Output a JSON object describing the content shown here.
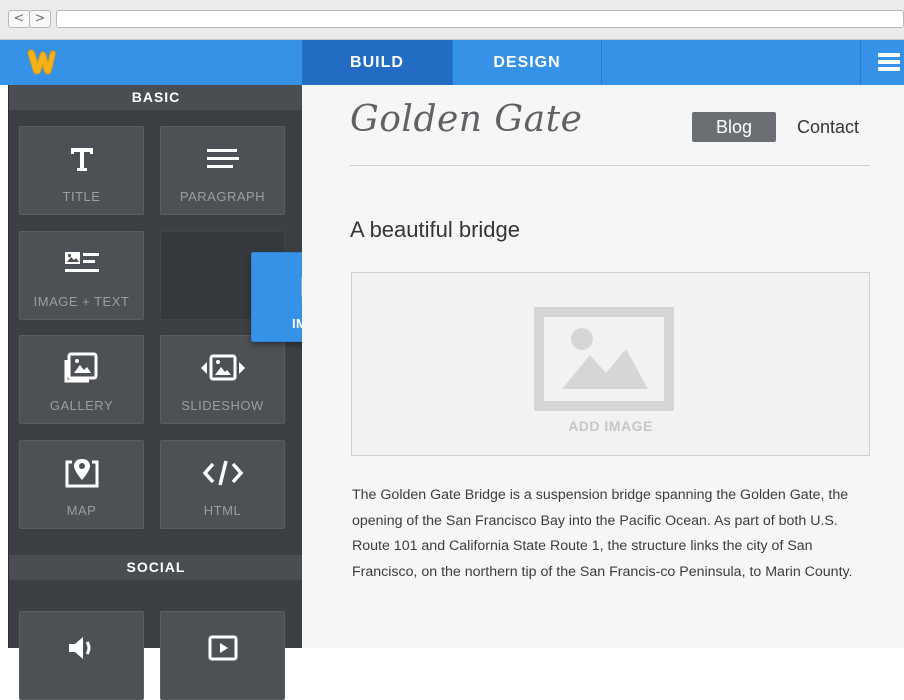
{
  "browser": {
    "back_glyph": "<",
    "forward_glyph": ">"
  },
  "topbar": {
    "logo_icon": "weebly-w-logo-icon",
    "tabs": [
      {
        "label": "BUILD",
        "active": true
      },
      {
        "label": "DESIGN",
        "active": false
      }
    ],
    "menu_icon": "hamburger-menu-icon",
    "accent_color": "#3592e7",
    "active_tab_color": "#226cc4"
  },
  "sidebar": {
    "sections": [
      {
        "heading": "BASIC",
        "tiles": [
          {
            "label": "TITLE",
            "icon": "title-t-icon"
          },
          {
            "label": "PARAGRAPH",
            "icon": "paragraph-lines-icon"
          },
          {
            "label": "IMAGE + TEXT",
            "icon": "image-text-icon"
          },
          {
            "label": "",
            "icon": ""
          },
          {
            "label": "GALLERY",
            "icon": "gallery-icon"
          },
          {
            "label": "SLIDESHOW",
            "icon": "slideshow-icon"
          },
          {
            "label": "MAP",
            "icon": "map-pin-icon"
          },
          {
            "label": "HTML",
            "icon": "html-code-icon"
          }
        ]
      },
      {
        "heading": "SOCIAL",
        "tiles": [
          {
            "label": "",
            "icon": "audio-speaker-icon"
          },
          {
            "label": "",
            "icon": "video-play-icon"
          }
        ]
      }
    ],
    "dragging_tile": {
      "label": "IMAGE",
      "icon": "image-icon"
    }
  },
  "site": {
    "title": "Golden Gate",
    "nav": [
      {
        "label": "Blog",
        "active": true
      },
      {
        "label": "Contact",
        "active": false
      }
    ],
    "heading": "A beautiful bridge",
    "image_placeholder": {
      "label": "ADD IMAGE",
      "icon": "image-placeholder-icon"
    },
    "paragraph": "The Golden Gate Bridge is a suspension bridge spanning the Golden Gate, the opening of the San Francisco Bay into the Pacific Ocean. As part of both U.S. Route 101 and California State Route 1, the structure links the city of San Francisco, on the northern tip of the San Francis-co Peninsula, to Marin County."
  }
}
